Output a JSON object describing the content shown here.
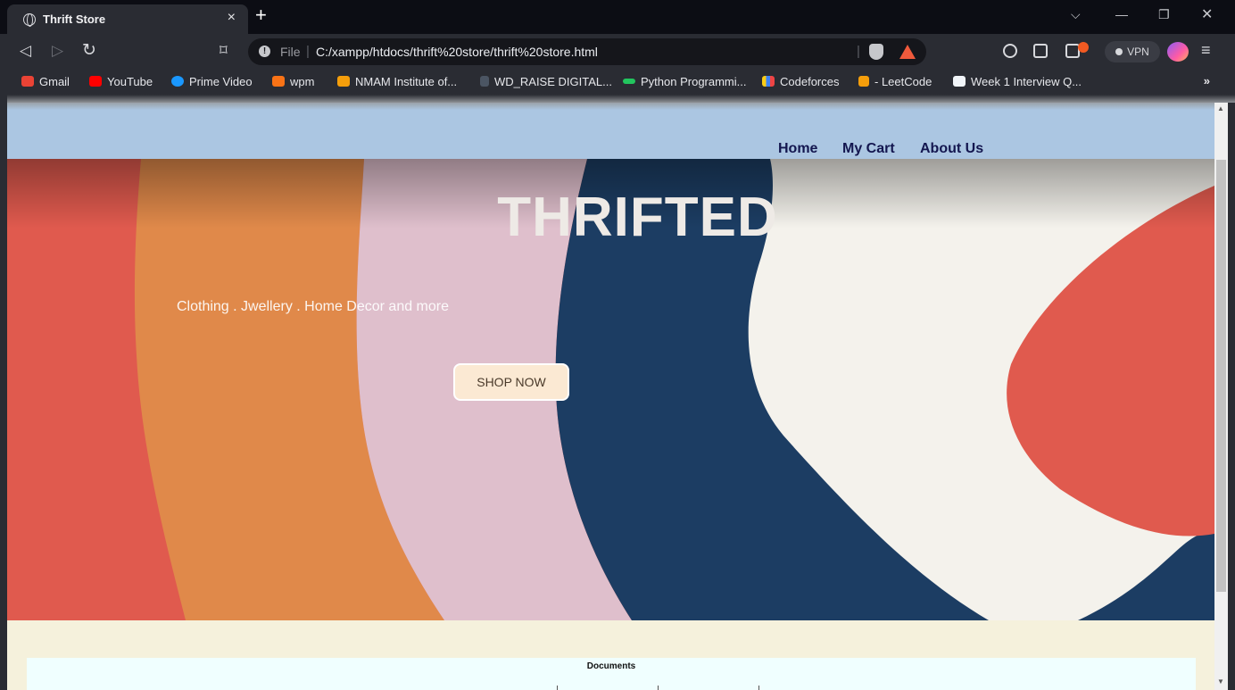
{
  "browser": {
    "tab_title": "Thrift Store",
    "tab_close": "×",
    "new_tab": "+",
    "url_scheme": "File",
    "url": "C:/xampp/htdocs/thrift%20store/thrift%20store.html",
    "vpn_label": "VPN",
    "bookmarks_more": "»",
    "bookmarks": [
      {
        "label": "Gmail",
        "icon": "gmail-icon",
        "color": "#ea4335"
      },
      {
        "label": "YouTube",
        "icon": "youtube-icon",
        "color": "#ff0000"
      },
      {
        "label": "Prime Video",
        "icon": "prime-video-icon",
        "color": "#1a98ff"
      },
      {
        "label": "wpm",
        "icon": "wpm-icon",
        "color": "#f97316"
      },
      {
        "label": "NMAM Institute of...",
        "icon": "nmam-icon",
        "color": "#f59e0b"
      },
      {
        "label": "WD_RAISE DIGITAL...",
        "icon": "raise-digital-icon",
        "color": "#9ca3af"
      },
      {
        "label": "Python Programmi...",
        "icon": "python-icon",
        "color": "#22c55e"
      },
      {
        "label": "Codeforces",
        "icon": "codeforces-icon",
        "color": "#3b82f6"
      },
      {
        "label": "- LeetCode",
        "icon": "leetcode-icon",
        "color": "#f59e0b"
      },
      {
        "label": "Week 1 Interview Q...",
        "icon": "week1-icon",
        "color": "#f1f5f9"
      }
    ]
  },
  "site": {
    "nav": {
      "home": "Home",
      "cart": "My Cart",
      "about": "About Us"
    },
    "hero": {
      "title": "THRIFTED",
      "subtitle": "Clothing . Jwellery . Home Decor and more",
      "cta": "SHOP NOW"
    },
    "documents_label": "Documents"
  },
  "colors": {
    "header_bg": "#abc6e2",
    "nav_text": "#13164f",
    "page_bg": "#f5f1dc",
    "docs_bg": "#f0ffff",
    "hero_red": "#e05a4e",
    "hero_orange": "#e0894a",
    "hero_pink": "#dfbfcc",
    "hero_navy": "#1c3d63",
    "hero_cream": "#f4f2ec"
  }
}
